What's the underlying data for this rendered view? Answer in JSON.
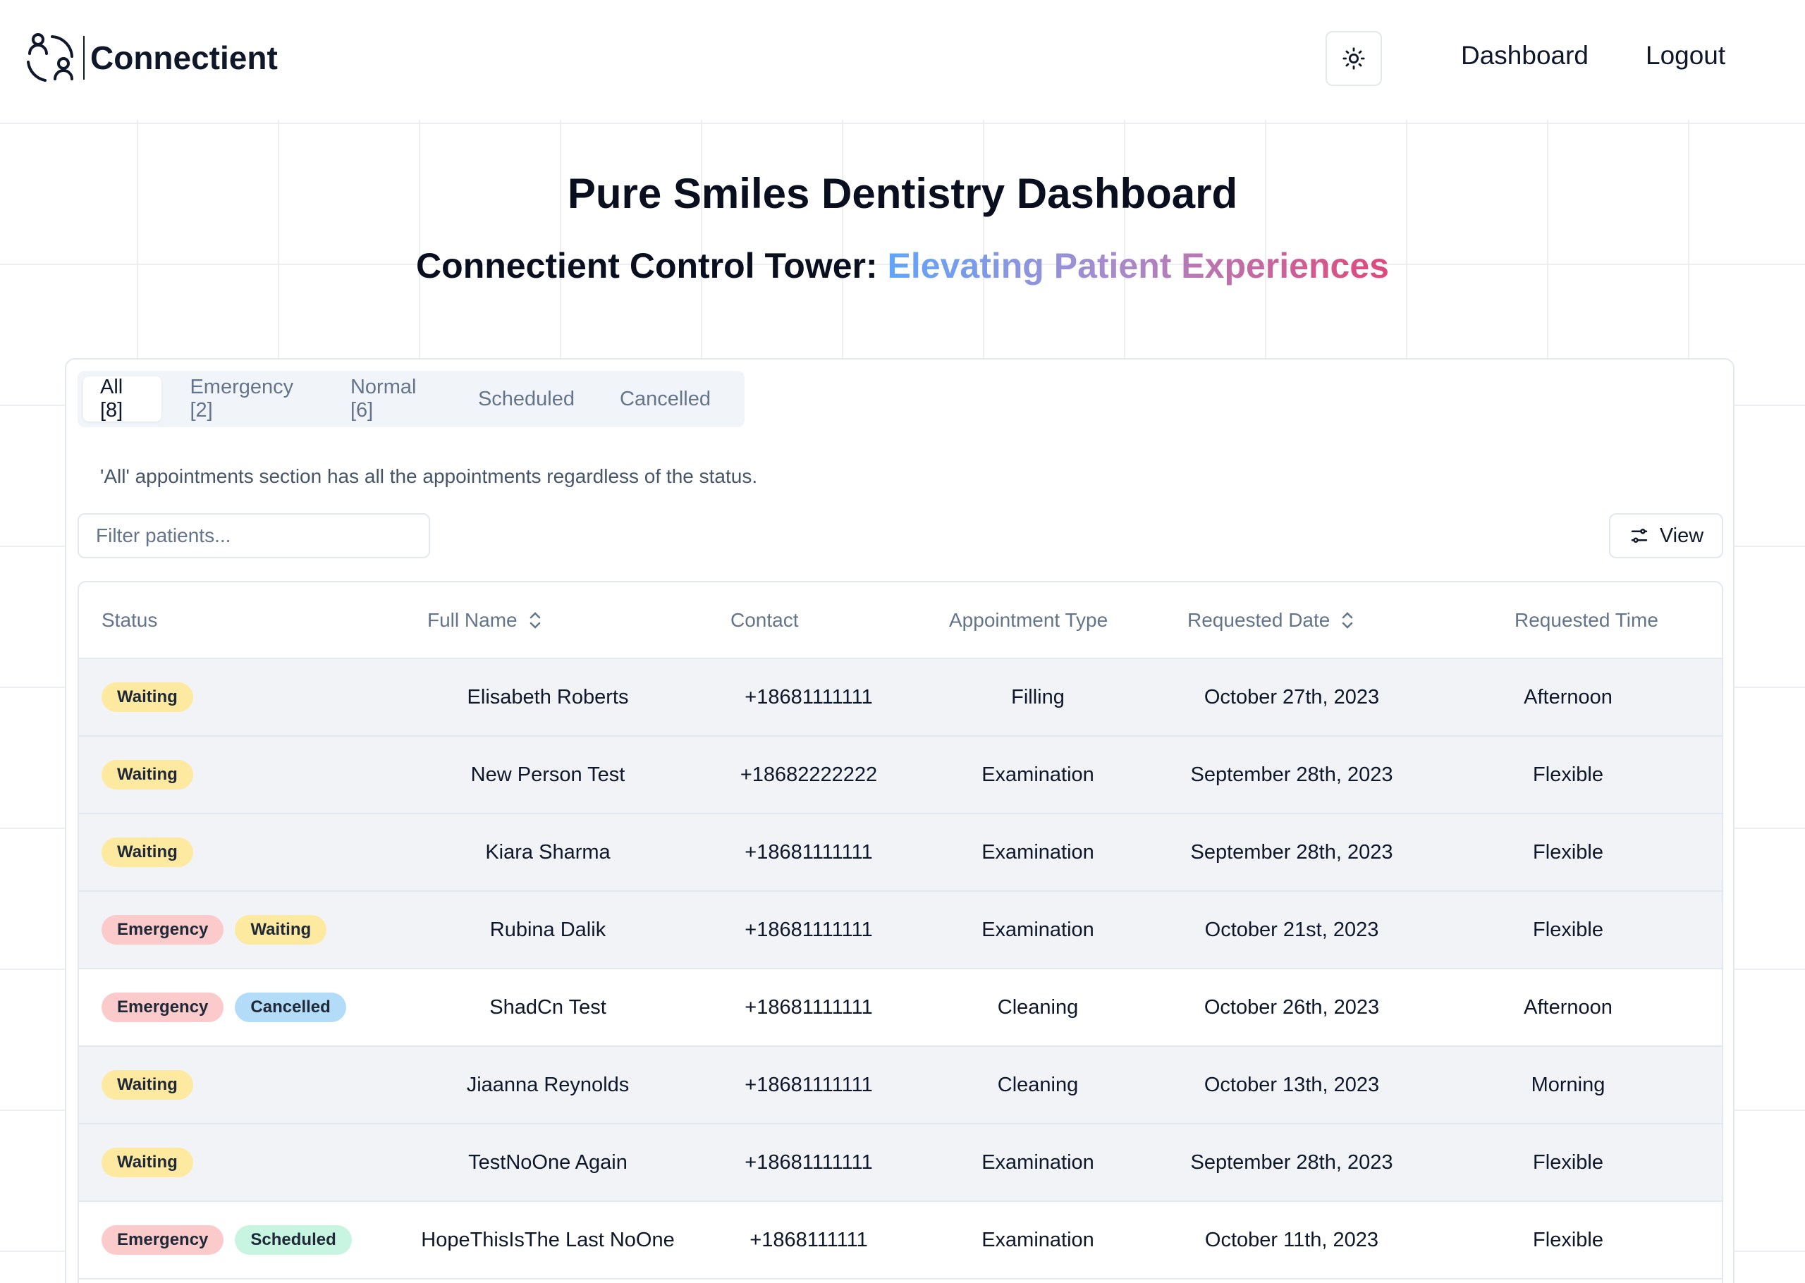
{
  "header": {
    "brand_name": "Connectient",
    "nav": {
      "dashboard": "Dashboard",
      "logout": "Logout"
    }
  },
  "hero": {
    "title": "Pure Smiles Dentistry Dashboard",
    "subtitle_prefix": "Connectient Control Tower: ",
    "subtitle_highlight": "Elevating Patient Experiences"
  },
  "tabs": [
    {
      "label": "All [8]",
      "active": true
    },
    {
      "label": "Emergency [2]",
      "active": false
    },
    {
      "label": "Normal [6]",
      "active": false
    },
    {
      "label": "Scheduled",
      "active": false
    },
    {
      "label": "Cancelled",
      "active": false
    }
  ],
  "description": "'All' appointments section has all the appointments regardless of the status.",
  "filter": {
    "placeholder": "Filter patients..."
  },
  "view_button": "View",
  "table": {
    "columns": [
      "Status",
      "Full Name",
      "Contact",
      "Appointment Type",
      "Requested Date",
      "Requested Time"
    ],
    "rows": [
      {
        "badges": [
          "Waiting"
        ],
        "name": "Elisabeth Roberts",
        "contact": "+18681111111",
        "type": "Filling",
        "date": "October 27th, 2023",
        "time": "Afternoon"
      },
      {
        "badges": [
          "Waiting"
        ],
        "name": "New Person Test",
        "contact": "+18682222222",
        "type": "Examination",
        "date": "September 28th, 2023",
        "time": "Flexible"
      },
      {
        "badges": [
          "Waiting"
        ],
        "name": "Kiara Sharma",
        "contact": "+18681111111",
        "type": "Examination",
        "date": "September 28th, 2023",
        "time": "Flexible"
      },
      {
        "badges": [
          "Emergency",
          "Waiting"
        ],
        "name": "Rubina Dalik",
        "contact": "+18681111111",
        "type": "Examination",
        "date": "October 21st, 2023",
        "time": "Flexible"
      },
      {
        "badges": [
          "Emergency",
          "Cancelled"
        ],
        "name": "ShadCn Test",
        "contact": "+18681111111",
        "type": "Cleaning",
        "date": "October 26th, 2023",
        "time": "Afternoon"
      },
      {
        "badges": [
          "Waiting"
        ],
        "name": "Jiaanna Reynolds",
        "contact": "+18681111111",
        "type": "Cleaning",
        "date": "October 13th, 2023",
        "time": "Morning"
      },
      {
        "badges": [
          "Waiting"
        ],
        "name": "TestNoOne Again",
        "contact": "+18681111111",
        "type": "Examination",
        "date": "September 28th, 2023",
        "time": "Flexible"
      },
      {
        "badges": [
          "Emergency",
          "Scheduled"
        ],
        "name": "HopeThisIsThe Last NoOne",
        "contact": "+1868111111",
        "type": "Examination",
        "date": "October 11th, 2023",
        "time": "Flexible"
      }
    ]
  },
  "colors": {
    "waiting_badge": "#fdeaa0",
    "emergency_badge": "#fbcaca",
    "cancelled_badge": "#b3dcf9",
    "scheduled_badge": "#c7f5e2",
    "gradient_start": "#60a5fa",
    "gradient_end": "#e0487a"
  },
  "icons": {
    "logo": "people-connect-icon",
    "theme": "sun-icon",
    "view": "sliders-icon",
    "sort": "chevron-up-down-icon"
  }
}
